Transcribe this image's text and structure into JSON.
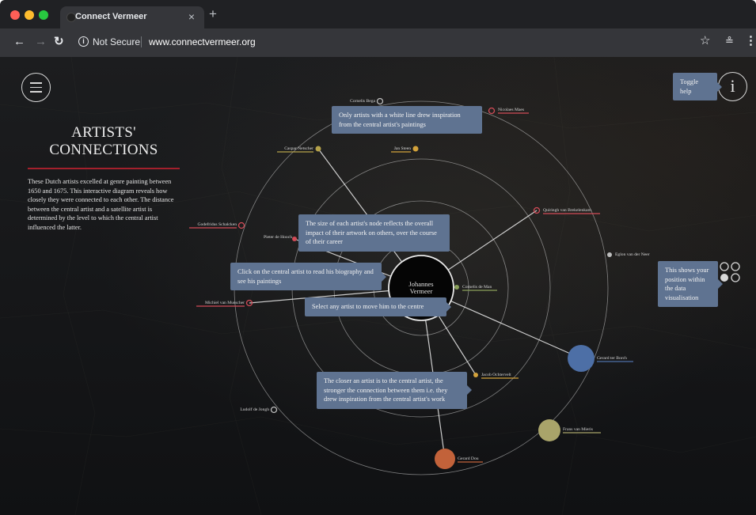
{
  "browser": {
    "tab_title": "Connect Vermeer",
    "tab_close": "×",
    "new_tab": "+",
    "security_label": "Not Secure",
    "url": "www.connectvermeer.org",
    "icons": [
      "back-arrow-icon",
      "forward-arrow-icon",
      "reload-icon",
      "info-icon",
      "star-icon",
      "extension-icon",
      "menu-dots-icon"
    ]
  },
  "page": {
    "title": "ARTISTS' CONNECTIONS",
    "intro": "These Dutch artists excelled at genre painting between 1650 and 1675. This interactive diagram reveals how closely they were connected to each other. The distance between the central artist and a satellite artist is determined by the level to which the central artist influenced the latter.",
    "accent_color": "#a3202c",
    "tooltip_color": "#5f7391"
  },
  "help": {
    "toggle": "Toggle help",
    "white_line": "Only artists with a white line drew inspiration from the central artist's paintings",
    "node_size": "The size of each artist's node reflects the overall impact of their artwork on others, over the course of their career",
    "central_click": "Click on the central artist to read his biography and see his paintings",
    "select_artist": "Select any artist to move him to the centre",
    "closer": "The closer an artist is to the central artist, the stronger the connection between them i.e. they drew inspiration from the central artist's work",
    "position": "This shows your position within the data visualisation"
  },
  "network": {
    "central": "Johannes Vermeer",
    "artists": [
      {
        "name": "Cornelis Bega",
        "color": "#bdbdbd",
        "connected": false
      },
      {
        "name": "Nicolaes Maes",
        "color": "#d24b57",
        "connected": false
      },
      {
        "name": "Caspar Netscher",
        "color": "#b5a24a",
        "connected": true
      },
      {
        "name": "Jan Steen",
        "color": "#d3a23b",
        "connected": false
      },
      {
        "name": "Quiringh van Brekelenkam",
        "color": "#d24b57",
        "connected": true
      },
      {
        "name": "Godefridus Schalcken",
        "color": "#d24b57",
        "connected": false
      },
      {
        "name": "Pieter de Hooch",
        "color": "#d24b57",
        "connected": true
      },
      {
        "name": "Eglon van der Neer",
        "color": "#bdbdbd",
        "connected": false
      },
      {
        "name": "Cornelis de Man",
        "color": "#8aa05a",
        "connected": true
      },
      {
        "name": "Michiel van Musscher",
        "color": "#d24b57",
        "connected": true
      },
      {
        "name": "Gerard ter Borch",
        "color": "#4d6fa6",
        "connected": true
      },
      {
        "name": "Jacob Ochtervelt",
        "color": "#d3a23b",
        "connected": true
      },
      {
        "name": "Ludolf de Jongh",
        "color": "#bdbdbd",
        "connected": false
      },
      {
        "name": "Frans van Mieris",
        "color": "#a9a46a",
        "connected": false
      },
      {
        "name": "Gerard Dou",
        "color": "#c2623a",
        "connected": true
      }
    ]
  }
}
